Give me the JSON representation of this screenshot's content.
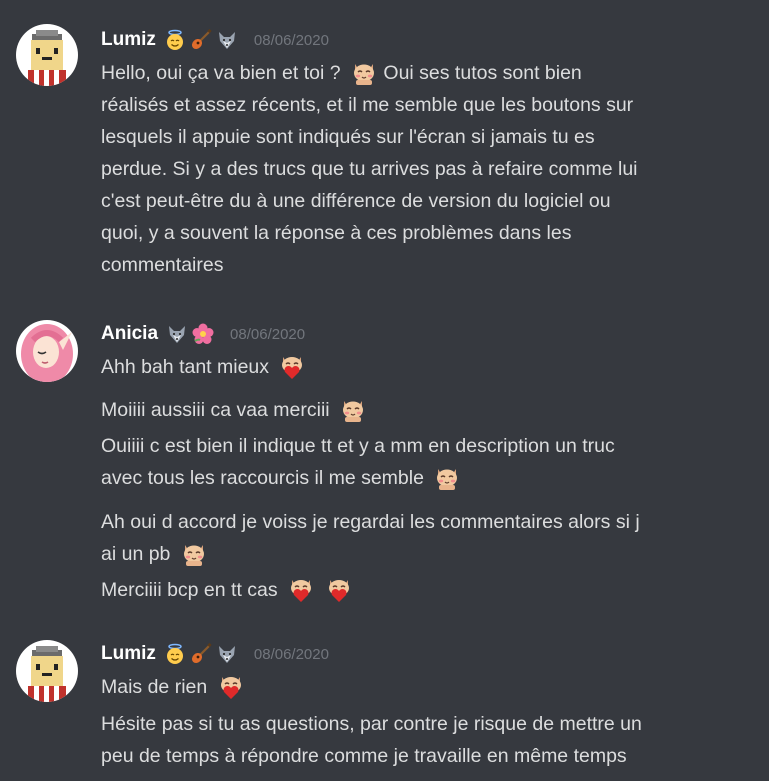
{
  "groups": [
    {
      "username": "Lumiz",
      "badges": [
        "angel-face-icon",
        "guitar-icon",
        "wolf-icon"
      ],
      "timestamp": "08/06/2020",
      "messages": [
        {
          "parts": [
            "Hello, oui ça va bien et toi ?",
            "Oui ses tutos sont bien",
            "réalisés et assez récents, et il me semble que les boutons sur",
            "lesquels il appuie sont indiqués sur l'écran si jamais tu es",
            "perdue. Si y a des trucs que tu arrives pas à refaire comme lui",
            "c'est peut-être du à une différence de version du logiciel ou",
            "quoi, y a souvent la réponse à ces problèmes dans les",
            "commentaires"
          ],
          "emoji": "cat-blush-emoji"
        }
      ]
    },
    {
      "username": "Anicia",
      "badges": [
        "wolf-icon",
        "hibiscus-icon"
      ],
      "timestamp": "08/06/2020",
      "messages": [
        {
          "text": "Ahh bah tant mieux",
          "emoji": [
            "cat-heart-emoji"
          ]
        },
        {
          "text": "Moiiii aussiii ca vaa merciii",
          "emoji": [
            "cat-blush-emoji"
          ]
        },
        {
          "lines": [
            "Ouiiii c est bien il indique tt et y a mm en description un truc",
            "avec tous les raccourcis il me semble"
          ],
          "emoji": [
            "cat-blush-emoji"
          ]
        },
        {
          "lines": [
            "Ah oui d accord je voiss je regardai les commentaires alors si j",
            "ai un pb"
          ],
          "emoji": [
            "cat-blush-emoji"
          ]
        },
        {
          "text": "Merciiii bcp en tt cas",
          "emoji": [
            "cat-heart-emoji",
            "cat-heart-emoji"
          ]
        }
      ]
    },
    {
      "username": "Lumiz",
      "badges": [
        "angel-face-icon",
        "guitar-icon",
        "wolf-icon"
      ],
      "timestamp": "08/06/2020",
      "messages": [
        {
          "text": "Mais de rien",
          "emoji": [
            "cat-heart-emoji"
          ]
        },
        {
          "lines": [
            "Hésite pas si tu as questions, par contre je risque de mettre un",
            "peu de temps à répondre comme je travaille en même temps"
          ]
        }
      ]
    }
  ]
}
